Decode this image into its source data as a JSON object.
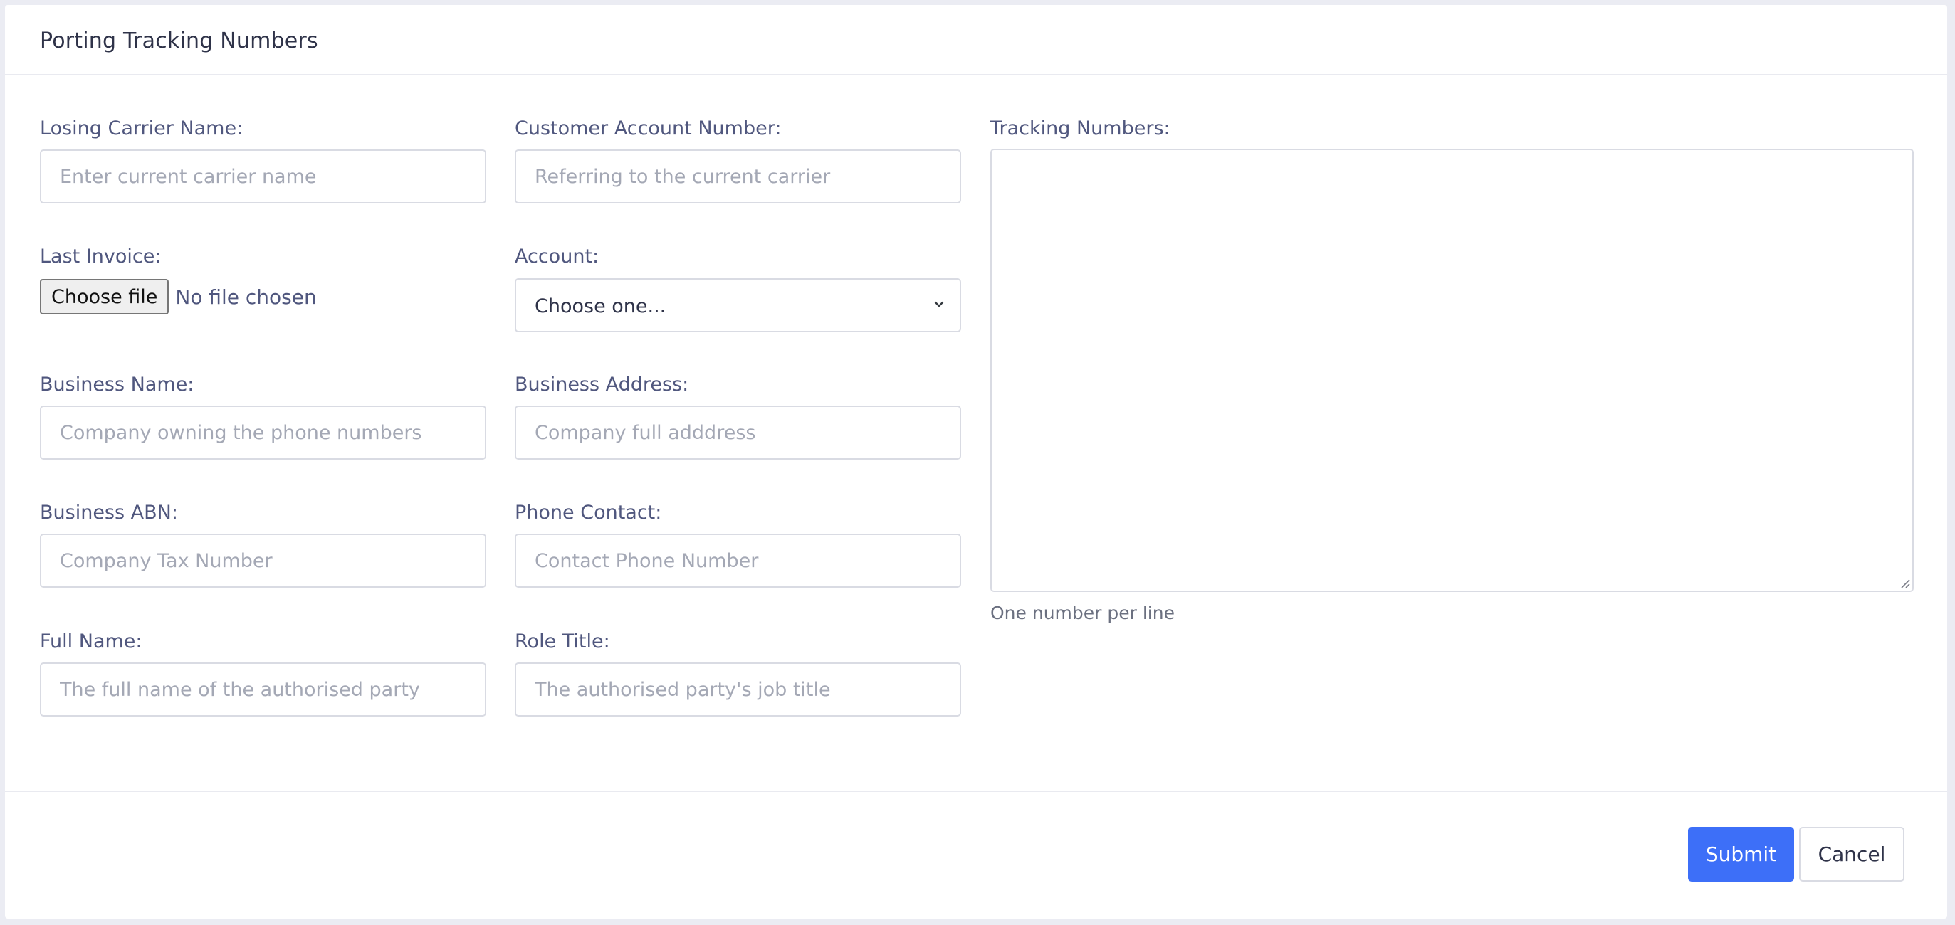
{
  "header": {
    "title": "Porting Tracking Numbers"
  },
  "form": {
    "losing_carrier": {
      "label": "Losing Carrier Name:",
      "placeholder": "Enter current carrier name",
      "value": ""
    },
    "customer_account": {
      "label": "Customer Account Number:",
      "placeholder": "Referring to the current carrier",
      "value": ""
    },
    "last_invoice": {
      "label": "Last Invoice:",
      "button_label": "Choose file",
      "status": "No file chosen"
    },
    "account": {
      "label": "Account:",
      "selected": "Choose one..."
    },
    "business_name": {
      "label": "Business Name:",
      "placeholder": "Company owning the phone numbers",
      "value": ""
    },
    "business_address": {
      "label": "Business Address:",
      "placeholder": "Company full adddress",
      "value": ""
    },
    "business_abn": {
      "label": "Business ABN:",
      "placeholder": "Company Tax Number",
      "value": ""
    },
    "phone_contact": {
      "label": "Phone Contact:",
      "placeholder": "Contact Phone Number",
      "value": ""
    },
    "full_name": {
      "label": "Full Name:",
      "placeholder": "The full name of the authorised party",
      "value": ""
    },
    "role_title": {
      "label": "Role Title:",
      "placeholder": "The authorised party's job title",
      "value": ""
    },
    "tracking_numbers": {
      "label": "Tracking Numbers:",
      "help": "One number per line",
      "value": ""
    }
  },
  "footer": {
    "submit_label": "Submit",
    "cancel_label": "Cancel"
  },
  "icons": {
    "select": "chevron-down-icon",
    "textarea": "resize-handle-icon"
  },
  "colors": {
    "primary": "#3d6ff8",
    "label": "#50577e",
    "background": "#ebecf3"
  }
}
